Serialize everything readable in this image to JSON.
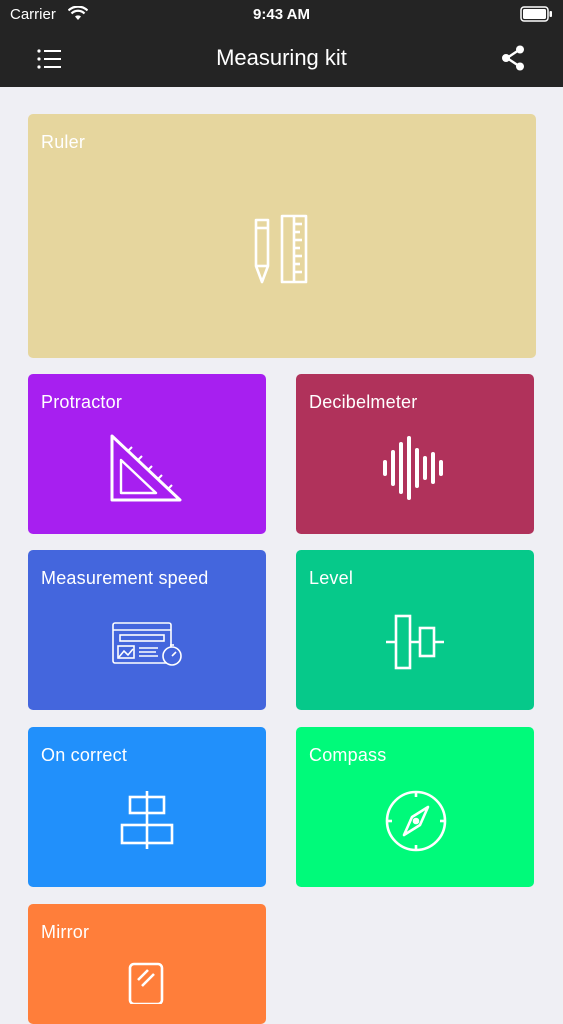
{
  "status": {
    "carrier": "Carrier",
    "time": "9:43 AM"
  },
  "nav": {
    "title": "Measuring kit",
    "menu_icon": "hamburger-list-icon",
    "share_icon": "share-icon"
  },
  "tiles": {
    "ruler": {
      "label": "Ruler",
      "color": "#e6d69e",
      "icon": "pencil-ruler-icon"
    },
    "protractor": {
      "label": "Protractor",
      "color": "#a71ff0",
      "icon": "triangle-ruler-icon"
    },
    "decibel": {
      "label": "Decibelmeter",
      "color": "#b0325b",
      "icon": "sound-wave-icon"
    },
    "speed": {
      "label": "Measurement speed",
      "color": "#4466dd",
      "icon": "speed-test-icon"
    },
    "level": {
      "label": "Level",
      "color": "#06c98a",
      "icon": "level-icon"
    },
    "oncorrect": {
      "label": "On correct",
      "color": "#2190fb",
      "icon": "align-center-icon"
    },
    "compass": {
      "label": "Compass",
      "color": "#00fa7a",
      "icon": "compass-icon"
    },
    "mirror": {
      "label": "Mirror",
      "color": "#ff7e3a",
      "icon": "mirror-icon"
    }
  }
}
